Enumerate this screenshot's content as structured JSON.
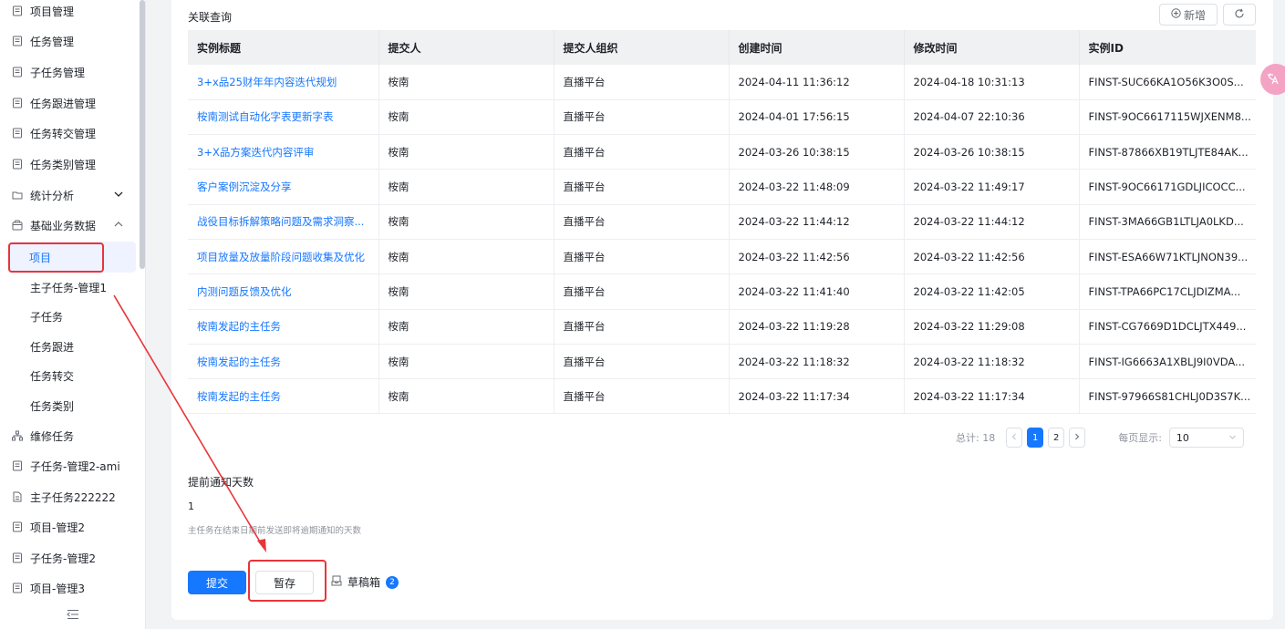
{
  "sidebar": {
    "items": [
      {
        "label": "项目管理",
        "icon": "doc-icon"
      },
      {
        "label": "任务管理",
        "icon": "doc-icon"
      },
      {
        "label": "子任务管理",
        "icon": "doc-icon"
      },
      {
        "label": "任务跟进管理",
        "icon": "doc-icon"
      },
      {
        "label": "任务转交管理",
        "icon": "doc-icon"
      },
      {
        "label": "任务类别管理",
        "icon": "doc-icon"
      },
      {
        "label": "统计分析",
        "icon": "folder-icon",
        "expanded": false
      },
      {
        "label": "基础业务数据",
        "icon": "box-icon",
        "expanded": true
      }
    ],
    "sub_items": [
      "项目",
      "主子任务-管理1",
      "子任务",
      "任务跟进",
      "任务转交",
      "任务类别"
    ],
    "active_sub": "项目",
    "more_items": [
      {
        "label": "维修任务",
        "icon": "tree-icon"
      },
      {
        "label": "子任务-管理2-ami",
        "icon": "doc-icon"
      },
      {
        "label": "主子任务222222",
        "icon": "file-icon"
      },
      {
        "label": "项目-管理2",
        "icon": "doc-icon"
      },
      {
        "label": "子任务-管理2",
        "icon": "doc-icon"
      },
      {
        "label": "项目-管理3",
        "icon": "doc-icon"
      }
    ]
  },
  "related": {
    "title": "关联查询",
    "new_label": "新增",
    "columns": [
      "实例标题",
      "提交人",
      "提交人组织",
      "创建时间",
      "修改时间",
      "实例ID"
    ],
    "rows": [
      [
        "3+x品25财年年内容迭代规划",
        "桉南",
        "直播平台",
        "2024-04-11 11:36:12",
        "2024-04-18 10:31:13",
        "FINST-SUC66KA1O56K3O0S..."
      ],
      [
        "桉南测试自动化字表更新字表",
        "桉南",
        "直播平台",
        "2024-04-01 17:56:15",
        "2024-04-07 22:10:36",
        "FINST-9OC6617115WJXENM8..."
      ],
      [
        "3+X品方案迭代内容评审",
        "桉南",
        "直播平台",
        "2024-03-26 10:38:15",
        "2024-03-26 10:38:15",
        "FINST-87866XB19TLJTE84AK..."
      ],
      [
        "客户案例沉淀及分享",
        "桉南",
        "直播平台",
        "2024-03-22 11:48:09",
        "2024-03-22 11:49:17",
        "FINST-9OC66171GDLJICOCC..."
      ],
      [
        "战役目标拆解策略问题及需求洞察...",
        "桉南",
        "直播平台",
        "2024-03-22 11:44:12",
        "2024-03-22 11:44:12",
        "FINST-3MA66GB1LTLJA0LKD..."
      ],
      [
        "项目放量及放量阶段问题收集及优化",
        "桉南",
        "直播平台",
        "2024-03-22 11:42:56",
        "2024-03-22 11:42:56",
        "FINST-ESA66W71KTLJNON39..."
      ],
      [
        "内测问题反馈及优化",
        "桉南",
        "直播平台",
        "2024-03-22 11:41:40",
        "2024-03-22 11:42:05",
        "FINST-TPA66PC17CLJDIZMA..."
      ],
      [
        "桉南发起的主任务",
        "桉南",
        "直播平台",
        "2024-03-22 11:19:28",
        "2024-03-22 11:29:08",
        "FINST-CG7669D1DCLJTX449..."
      ],
      [
        "桉南发起的主任务",
        "桉南",
        "直播平台",
        "2024-03-22 11:18:32",
        "2024-03-22 11:18:32",
        "FINST-IG6663A1XBLJ9I0VDA..."
      ],
      [
        "桉南发起的主任务",
        "桉南",
        "直播平台",
        "2024-03-22 11:17:34",
        "2024-03-22 11:17:34",
        "FINST-97966S81CHLJ0D3S7K..."
      ]
    ],
    "pager": {
      "total_label": "总计: 18",
      "pages": [
        "1",
        "2"
      ],
      "current": "1",
      "page_size_label": "每页显示:",
      "page_size": "10"
    }
  },
  "form": {
    "field_label": "提前通知天数",
    "field_value": "1",
    "field_hint": "主任务在结束日期前发送即将逾期通知的天数",
    "submit_label": "提交",
    "save_label": "暂存",
    "drafts_label": "草稿箱",
    "drafts_count": "2"
  },
  "colors": {
    "accent": "#1677ff",
    "annotation": "#e8353a"
  }
}
